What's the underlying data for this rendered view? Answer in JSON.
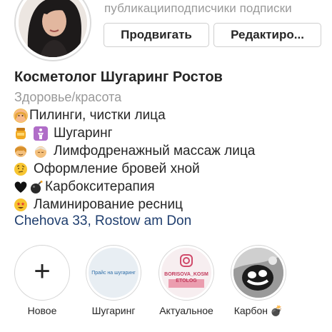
{
  "profile": {
    "stats_text": [
      "публикации",
      "подписчики",
      "подписки"
    ],
    "promote_label": "Продвигать",
    "edit_label": "Редактиро...",
    "name": "Косметолог Шугаринг Ростов",
    "category": "Здоровье/красота",
    "address": "Chehova 33, Rostow am Don"
  },
  "bio": {
    "lines": [
      "Пилинги, чистки лица",
      "Шугаринг",
      "Лимфодренажный массаж лица",
      "Оформление бровей хной",
      "Карбокситерапия",
      "Ламинирование ресниц"
    ],
    "emoji_icons": [
      [
        "woman-icon"
      ],
      [
        "honey-jar-icon",
        "restroom-icon"
      ],
      [
        "massage-icon",
        "spa-woman-icon"
      ],
      [
        "raised-eyebrow-face-icon"
      ],
      [
        "black-heart-icon",
        "bomb-icon"
      ],
      [
        "star-struck-face-icon"
      ]
    ]
  },
  "highlights": [
    {
      "label": "Новое",
      "icon": "plus-icon"
    },
    {
      "label": "Шугаринг",
      "cover_text": "Прайс на шугаринг"
    },
    {
      "label": "Актуальное",
      "cover_text": "BORISOVA_KOSMETOLOG"
    },
    {
      "label": "Карбон 💣"
    }
  ],
  "colors": {
    "link": "#1f3e6e",
    "muted": "#999999",
    "border": "#dbdbdb"
  }
}
